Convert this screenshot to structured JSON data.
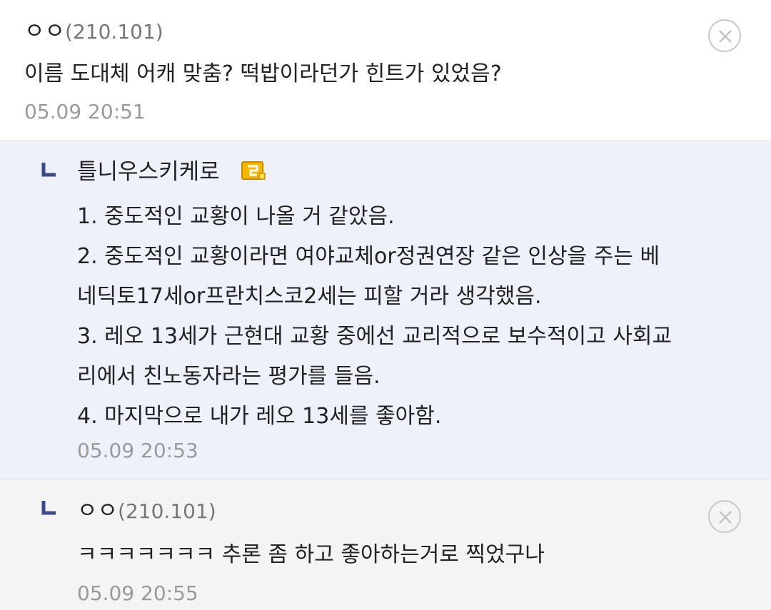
{
  "comments": [
    {
      "nick": "ㅇㅇ",
      "ip": "(210.101)",
      "lines": [
        "이름 도대체 어캐 맞춤? 떡밥이라던가 힌트가 있었음?"
      ],
      "time": "05.09 20:51",
      "is_reply": false,
      "deletable": true
    },
    {
      "nick": "틀니우스키케로",
      "ip": "",
      "lines": [
        "1. 중도적인 교황이 나올 거 같았음.",
        "2. 중도적인 교황이라면 여야교체or정권연장 같은 인상을 주는 베",
        "네딕토17세or프란치스코2세는 피할 거라 생각했음.",
        "3. 레오 13세가 근현대 교황 중에선 교리적으로 보수적이고 사회교",
        "리에서 친노동자라는 평가를 들음.",
        "4. 마지막으로 내가 레오 13세를 좋아함."
      ],
      "time": "05.09 20:53",
      "is_reply": true,
      "deletable": false
    },
    {
      "nick": "ㅇㅇ",
      "ip": "(210.101)",
      "lines": [
        "ㅋㅋㅋㅋㅋㅋㅋ 추론 좀 하고 좋아하는거로 찍었구나"
      ],
      "time": "05.09 20:55",
      "is_reply": true,
      "deletable": true
    }
  ],
  "colors": {
    "reply_background": "#eef1fa",
    "nested_background": "#f4f4f4",
    "reply_mark": "#3b4a8c",
    "badge": "#f5b700"
  }
}
